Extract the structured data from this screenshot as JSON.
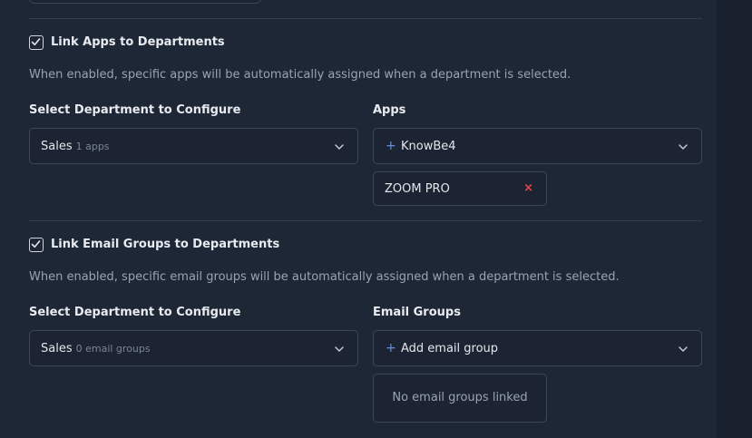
{
  "apps_section": {
    "checkbox_checked": true,
    "title": "Link Apps to Departments",
    "description": "When enabled, specific apps will be automatically assigned when a department is selected.",
    "department_label": "Select Department to Configure",
    "department_value": "Sales",
    "department_count": "1 apps",
    "apps_label": "Apps",
    "apps_select_value": "KnowBe4",
    "selected_chips": [
      {
        "label": "ZOOM PRO",
        "remove_icon": "×"
      }
    ]
  },
  "email_section": {
    "checkbox_checked": true,
    "title": "Link Email Groups to Departments",
    "description": "When enabled, specific email groups will be automatically assigned when a department is selected.",
    "department_label": "Select Department to Configure",
    "department_value": "Sales",
    "department_count": "0 email groups",
    "groups_label": "Email Groups",
    "groups_select_placeholder": "Add email group",
    "empty_state": "No email groups linked"
  },
  "icons": {
    "plus": "+",
    "chevron": "chevron-down-icon",
    "check": "check-icon"
  },
  "colors": {
    "background": "#1e2736",
    "accent": "#6b8fd6",
    "danger": "#ef4444"
  }
}
